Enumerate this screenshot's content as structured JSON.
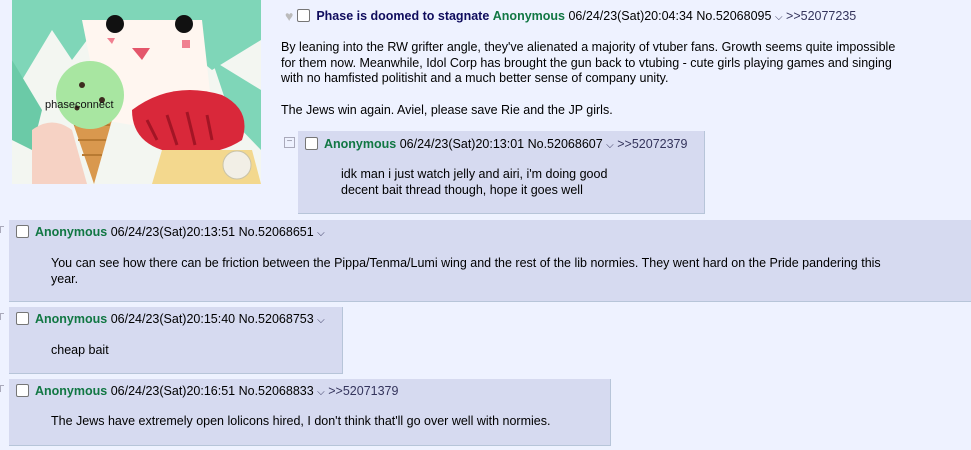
{
  "op": {
    "subject": "Phase is doomed to stagnate",
    "name": "Anonymous",
    "datetime": "06/24/23(Sat)20:04:34",
    "post_no": "No.52068095",
    "backlink": ">>52077235",
    "body": [
      "By leaning into the RW grifter angle, they've alienated a majority of vtuber fans. Growth seems quite impossible",
      "for them now. Meanwhile, Idol Corp has brought the gun back to vtubing - cute girls playing games and singing",
      "with no hamfisted politishit and a much better sense of company unity.",
      "The Jews win again. Aviel, please save Rie and the JP girls."
    ],
    "image_text": "phaseconnect"
  },
  "replies": [
    {
      "name": "Anonymous",
      "datetime": "06/24/23(Sat)20:13:01",
      "post_no": "No.52068607",
      "backlink": ">>52072379",
      "body": [
        "idk man i just watch jelly and airi, i'm doing good",
        "decent bait thread though, hope it goes well"
      ]
    },
    {
      "name": "Anonymous",
      "datetime": "06/24/23(Sat)20:13:51",
      "post_no": "No.52068651",
      "backlink": "",
      "body": [
        "You can see how there can be friction between the Pippa/Tenma/Lumi wing and the rest of the lib normies. They went hard on the Pride pandering this",
        "year."
      ]
    },
    {
      "name": "Anonymous",
      "datetime": "06/24/23(Sat)20:15:40",
      "post_no": "No.52068753",
      "backlink": "",
      "body": [
        "cheap bait"
      ]
    },
    {
      "name": "Anonymous",
      "datetime": "06/24/23(Sat)20:16:51",
      "post_no": "No.52068833",
      "backlink": ">>52071379",
      "body": [
        "The Jews have extremely open lolicons hired, I don't think that'll go over well with normies."
      ]
    }
  ],
  "icons": {
    "chevron": "chevron-down-icon",
    "heart": "heart-icon",
    "collapse": "minus-icon"
  },
  "colors": {
    "background": "#eef2ff",
    "reply_bg": "#d6daf0",
    "name": "#117743",
    "subject": "#0f0c5d"
  }
}
